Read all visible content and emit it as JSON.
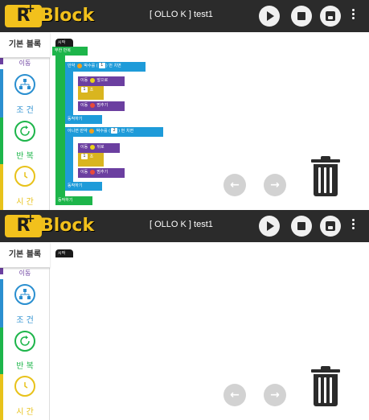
{
  "app": {
    "logo_r": "R",
    "logo_plus": "+",
    "logo_block": "Block",
    "title": "[ OLLO K ]  test1"
  },
  "sidebar": {
    "active_tab": "기본 블록",
    "partial_label": "이동",
    "categories": [
      {
        "label": "조 건",
        "icon": "sitemap-icon",
        "color": "#2a8fd0"
      },
      {
        "label": "반 복",
        "icon": "refresh-icon",
        "color": "#1db54a"
      },
      {
        "label": "시 간",
        "icon": "clock-icon",
        "color": "#e8c21a"
      }
    ]
  },
  "blocks": {
    "start": "시작",
    "loop": "무한 반복",
    "if_prefix": "만약",
    "if_suffix": "박수를 (",
    "if_num": "1",
    "if_tail": ") 번 치면",
    "move": "이동",
    "forward": "앞으로",
    "sec_num": "1",
    "sec": "초",
    "stop": "멈추기",
    "do": "동작하기",
    "else_prefix": "아니면 만약",
    "else_suffix": "박수를 (",
    "else_num": "2",
    "else_tail": ") 번 치면",
    "backward": "뒤로",
    "loop_end": "동작하기"
  },
  "colors": {
    "header": "#2b2b2b",
    "logo_yellow": "#f2c11c",
    "block_green": "#1db54a",
    "block_blue": "#1e9bd9",
    "block_purple": "#6b3fa0",
    "block_yellow": "#d9b51f"
  },
  "icons": {
    "play": "play-icon",
    "stop": "stop-icon",
    "save": "save-icon",
    "menu": "kebab-menu-icon",
    "undo": "arrow-left-icon",
    "redo": "arrow-right-icon",
    "trash": "trash-icon"
  }
}
